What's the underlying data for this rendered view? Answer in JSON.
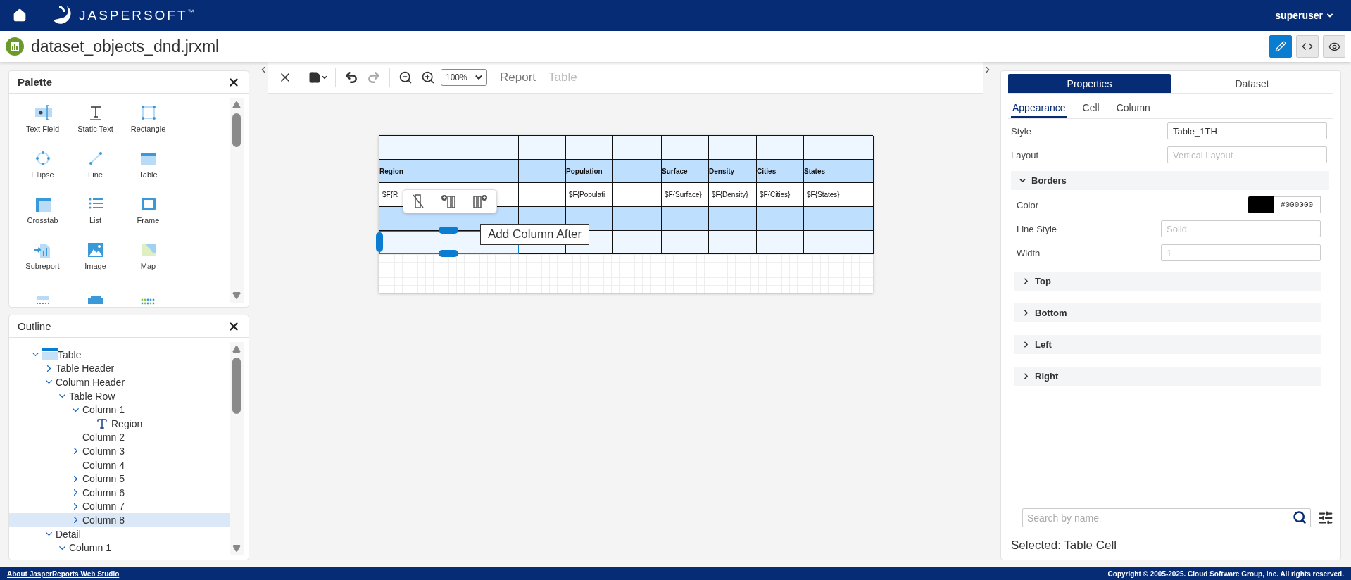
{
  "header": {
    "logo": "JASPERSOFT",
    "trademark": "™",
    "user": "superuser"
  },
  "title_bar": {
    "filename": "dataset_objects_dnd.jrxml",
    "view_modes": [
      {
        "kind": "design",
        "selected": true
      },
      {
        "kind": "source",
        "selected": false
      },
      {
        "kind": "preview",
        "selected": false
      }
    ]
  },
  "palette": {
    "title": "Palette",
    "items": [
      {
        "kind": "textfield",
        "label": "Text Field"
      },
      {
        "kind": "statictext",
        "label": "Static Text"
      },
      {
        "kind": "rectangle",
        "label": "Rectangle"
      },
      {
        "kind": "ellipse",
        "label": "Ellipse"
      },
      {
        "kind": "line",
        "label": "Line"
      },
      {
        "kind": "table",
        "label": "Table"
      },
      {
        "kind": "crosstab",
        "label": "Crosstab"
      },
      {
        "kind": "list",
        "label": "List"
      },
      {
        "kind": "frame",
        "label": "Frame"
      },
      {
        "kind": "subreport",
        "label": "Subreport"
      },
      {
        "kind": "image",
        "label": "Image"
      },
      {
        "kind": "map",
        "label": "Map"
      },
      {
        "kind": "pagebreak"
      },
      {
        "kind": "band"
      },
      {
        "kind": "dots"
      }
    ]
  },
  "outline": {
    "title": "Outline",
    "items": [
      {
        "label": "Table",
        "kind": "table",
        "expanded": true,
        "selected": false,
        "children": [
          {
            "label": "Table Header",
            "expanded": false,
            "selected": false
          },
          {
            "label": "Column Header",
            "expanded": true,
            "selected": false,
            "children": [
              {
                "label": "Table Row",
                "expanded": true,
                "selected": false,
                "children": [
                  {
                    "label": "Column 1",
                    "expanded": true,
                    "selected": false,
                    "children": [
                      {
                        "label": "Region",
                        "kind": "text",
                        "selected": false
                      }
                    ]
                  },
                  {
                    "label": "Column 2",
                    "selected": false
                  },
                  {
                    "label": "Column 3",
                    "expanded": false,
                    "selected": false
                  },
                  {
                    "label": "Column 4",
                    "selected": false
                  },
                  {
                    "label": "Column 5",
                    "expanded": false,
                    "selected": false
                  },
                  {
                    "label": "Column 6",
                    "expanded": false,
                    "selected": false
                  },
                  {
                    "label": "Column 7",
                    "expanded": false,
                    "selected": false
                  },
                  {
                    "label": "Column 8",
                    "expanded": false,
                    "selected": true
                  }
                ]
              }
            ]
          },
          {
            "label": "Detail",
            "expanded": true,
            "selected": false,
            "children": [
              {
                "label": "Column 1",
                "expanded": true,
                "selected": false
              }
            ]
          }
        ]
      }
    ]
  },
  "canvas_toolbar": {
    "tools": [
      {
        "kind": "undo",
        "disabled": false
      },
      {
        "kind": "redo",
        "disabled": true
      }
    ],
    "zoom": "100%",
    "breadcrumb": [
      {
        "label": "Report",
        "disabled": false
      },
      {
        "label": "Table",
        "disabled": true
      }
    ]
  },
  "table": {
    "rows": [
      {
        "kind": "table_header",
        "cells": [
          {
            "selected": false
          },
          {
            "selected": false
          },
          {
            "selected": false
          },
          {
            "selected": false
          },
          {
            "selected": false
          },
          {
            "selected": false
          },
          {
            "selected": false
          },
          {
            "selected": false
          }
        ]
      },
      {
        "kind": "column_header",
        "cells": [
          {
            "text": "Region",
            "selected": false
          },
          {
            "selected": false
          },
          {
            "text": "Population",
            "selected": false
          },
          {
            "selected": false
          },
          {
            "text": "Surface",
            "selected": false
          },
          {
            "text": "Density",
            "selected": false
          },
          {
            "text": "Cities",
            "selected": false
          },
          {
            "text": "States",
            "selected": false
          }
        ]
      },
      {
        "kind": "detail",
        "cells": [
          {
            "text": "$F{R",
            "selected": false
          },
          {
            "selected": false
          },
          {
            "text": "$F{Populati",
            "selected": false
          },
          {
            "selected": false
          },
          {
            "text": "$F{Surface}",
            "selected": false
          },
          {
            "text": "$F{Density}",
            "selected": false
          },
          {
            "text": "$F{Cities}",
            "selected": false
          },
          {
            "text": "$F{States}",
            "selected": false
          }
        ]
      },
      {
        "kind": "column_footer",
        "cells": [
          {
            "selected": false
          },
          {
            "selected": false
          },
          {
            "selected": false
          },
          {
            "selected": false
          },
          {
            "selected": false
          },
          {
            "selected": false
          },
          {
            "selected": false
          },
          {
            "selected": false
          }
        ]
      },
      {
        "kind": "table_footer",
        "cells": [
          {
            "selected": true
          },
          {
            "selected": false
          },
          {
            "selected": false
          },
          {
            "selected": false
          },
          {
            "selected": false
          },
          {
            "selected": false
          },
          {
            "selected": false
          },
          {
            "selected": false
          }
        ]
      }
    ]
  },
  "cell_toolbar": {
    "tools": [
      {
        "kind": "delete_column"
      },
      {
        "kind": "add_before"
      },
      {
        "kind": "add_after"
      }
    ]
  },
  "tooltip": "Add Column After",
  "properties": {
    "tabs": [
      {
        "label": "Properties",
        "selected": true
      },
      {
        "label": "Dataset",
        "selected": false
      }
    ],
    "subtabs": [
      {
        "label": "Appearance",
        "selected": true
      },
      {
        "label": "Cell",
        "selected": false
      },
      {
        "label": "Column",
        "selected": false
      }
    ],
    "fields": [
      {
        "label": "Style",
        "value": "Table_1TH"
      },
      {
        "label": "Layout",
        "placeholder": "Vertical Layout"
      }
    ],
    "borders": {
      "title": "Borders",
      "expanded": true,
      "color_label": "Color",
      "color": "#000000",
      "color_text": "#000000",
      "fields": [
        {
          "label": "Line Style",
          "placeholder": "Solid"
        },
        {
          "label": "Width",
          "placeholder": "1"
        }
      ],
      "sections": [
        {
          "title": "Top",
          "expanded": false
        },
        {
          "title": "Bottom",
          "expanded": false
        },
        {
          "title": "Left",
          "expanded": false
        },
        {
          "title": "Right",
          "expanded": false
        }
      ]
    },
    "search": {
      "placeholder": "Search by name"
    },
    "selected": "Selected: Table Cell"
  },
  "footer": {
    "about": "About JasperReports Web Studio",
    "copyright": "Copyright © 2005-2025. Cloud Software Group, Inc. All rights reserved."
  }
}
